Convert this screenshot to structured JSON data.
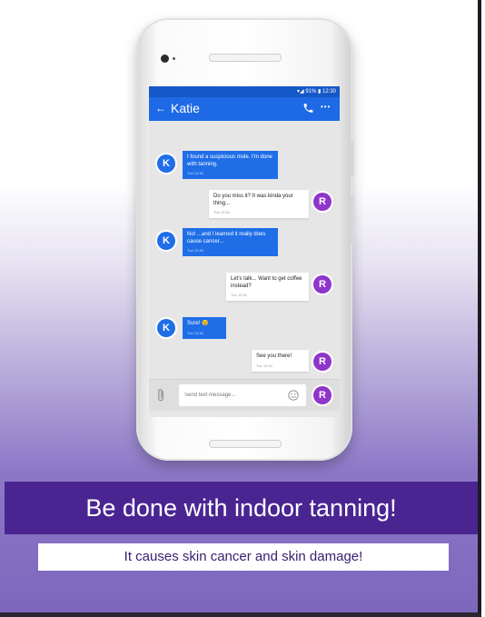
{
  "status_bar": {
    "text": "▾◢ 91% ▮ 12:30"
  },
  "app_bar": {
    "contact_name": "Katie",
    "back_icon": "arrow-left-icon",
    "call_icon": "phone-icon",
    "more_icon": "more-icon"
  },
  "avatars": {
    "katie": "K",
    "me": "R"
  },
  "messages": [
    {
      "sender": "Katie",
      "text": "I found a suspicious mole. I'm done with tanning.",
      "time": "Tue 12:30"
    },
    {
      "sender": "Me",
      "text": "Do you miss it? It was kinda your thing...",
      "time": "Tue 12:30"
    },
    {
      "sender": "Katie",
      "text": "No! ...and I learned it really does cause cancer...",
      "time": "Tue 12:30"
    },
    {
      "sender": "Me",
      "text": "Let's talk... Want to get coffee instead?",
      "time": "Tue 12:30"
    },
    {
      "sender": "Katie",
      "text": "Sure! 😉",
      "time": "Tue 12:30"
    },
    {
      "sender": "Me",
      "text": "See you there!",
      "time": "Tue 12:30"
    }
  ],
  "composer": {
    "placeholder": "Send text message...",
    "attach_icon": "paperclip-icon",
    "emoji_icon": "smiley-icon"
  },
  "headline": "Be done with indoor tanning!",
  "subheadline": "It causes skin cancer and skin damage!",
  "colors": {
    "in_bubble": "#1f6ee8",
    "app_bar": "#1e6ae6",
    "avatar_me": "#8f35c9",
    "banner": "#4a2592",
    "poster_bottom": "#7d67bd"
  }
}
